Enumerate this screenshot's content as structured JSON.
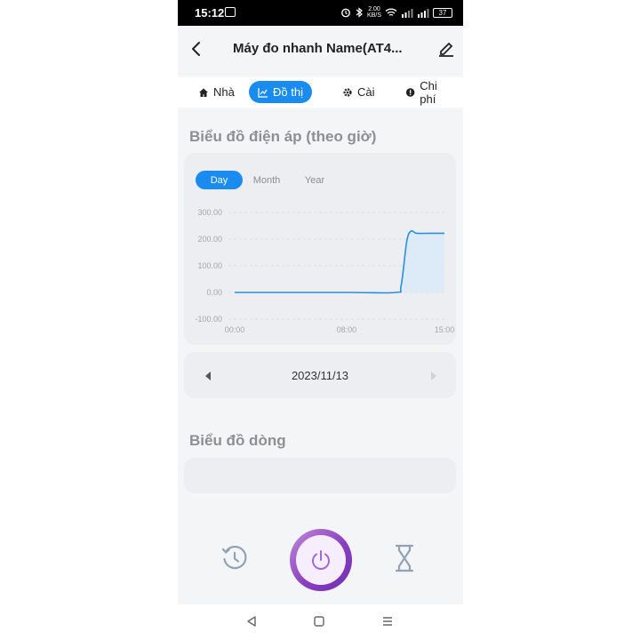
{
  "status_bar": {
    "time": "15:12",
    "net_speed_value": "2.00",
    "net_speed_unit": "KB/S",
    "battery": "37"
  },
  "header": {
    "title": "Máy đo nhanh Name(AT4..."
  },
  "tabs": [
    {
      "label": "Nhà",
      "icon": "home-icon",
      "active": false
    },
    {
      "label": "Đồ thị",
      "icon": "chart-icon",
      "active": true
    },
    {
      "label": "Cài",
      "icon": "gear-icon",
      "active": false
    },
    {
      "label": "Chi phí",
      "icon": "cost-icon",
      "active": false
    }
  ],
  "voltage_section": {
    "title": "Biểu đồ điện áp (theo giờ)",
    "range_options": [
      "Day",
      "Month",
      "Year"
    ],
    "selected_range": "Day"
  },
  "date_nav": {
    "date": "2023/11/13"
  },
  "current_section": {
    "title": "Biểu đồ dòng"
  },
  "colors": {
    "accent": "#1a8cf0",
    "power_button": "#8b3fc0",
    "line": "#2a8fe0",
    "area": "#dbeaf9"
  },
  "chart_data": {
    "type": "area",
    "title": "",
    "xlabel": "",
    "ylabel": "",
    "ylim": [
      -100,
      300
    ],
    "yticks": [
      "300.00",
      "200.00",
      "100.00",
      "0.00",
      "-100.00"
    ],
    "xticks": [
      "00:00",
      "08:00",
      "15:00"
    ],
    "xlim": [
      0,
      15
    ],
    "grid": true,
    "series": [
      {
        "x": [
          0,
          8,
          11.5,
          11.9,
          12.3,
          12.6,
          13.0,
          14.0,
          15.0
        ],
        "values": [
          0,
          0,
          0,
          25,
          190,
          230,
          222,
          222,
          222
        ]
      }
    ]
  }
}
